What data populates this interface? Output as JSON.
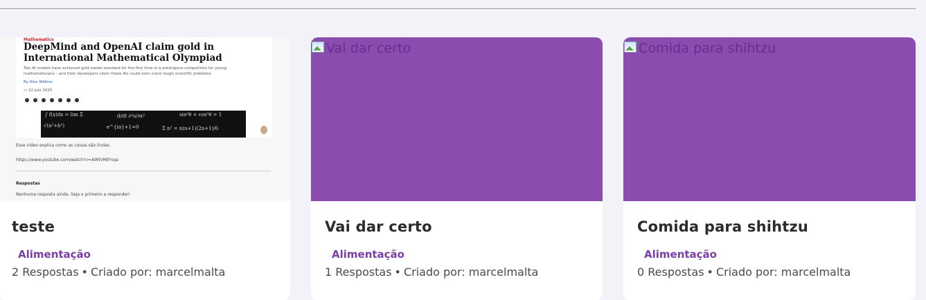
{
  "cards": [
    {
      "title": "teste",
      "category": "Alimentação",
      "responses": "2 Respostas",
      "separator": "•",
      "created_by": "Criado por: marcelmalta",
      "thumbnail": {
        "kicker": "Mathematics",
        "headline": "DeepMind and OpenAI claim gold in International Mathematical Olympiad",
        "summary": "Two AI models have achieved gold medal standard for the first time in a prestigious competition for young mathematicians – and their developers claim these AIs could soon crack tough scientific problems",
        "byline": "By Alex Wilkins",
        "date": "22 July 2025",
        "equations": [
          "∫ f(x)dx = lim Σ",
          "d/dt ∂²u/∂x²",
          "sin²θ + cos²θ = 1",
          "√(a²+b²)",
          "e^{iπ}+1=0",
          "Σ n² = n(n+1)(2n+1)/6"
        ],
        "description_line": "Esse vídeo explica como as coisas são lindas.",
        "link_line": "https://www.youtube.com/watch?v=AIMlVMtFnqa",
        "responses_heading": "Respostas",
        "empty_responses": "Nenhuma resposta ainda. Seja o primeiro a responder!"
      }
    },
    {
      "title": "Vai dar certo",
      "image_alt": "Vai dar certo",
      "category": "Alimentação",
      "responses": "1 Respostas",
      "separator": "•",
      "created_by": "Criado por: marcelmalta"
    },
    {
      "title": "Comida para shihtzu",
      "image_alt": "Comida para shihtzu",
      "category": "Alimentação",
      "responses": "0 Respostas",
      "separator": "•",
      "created_by": "Criado por: marcelmalta"
    }
  ],
  "colors": {
    "accent": "#8a4caf",
    "tag": "#7b3ea6",
    "background": "#f3f2f8"
  }
}
